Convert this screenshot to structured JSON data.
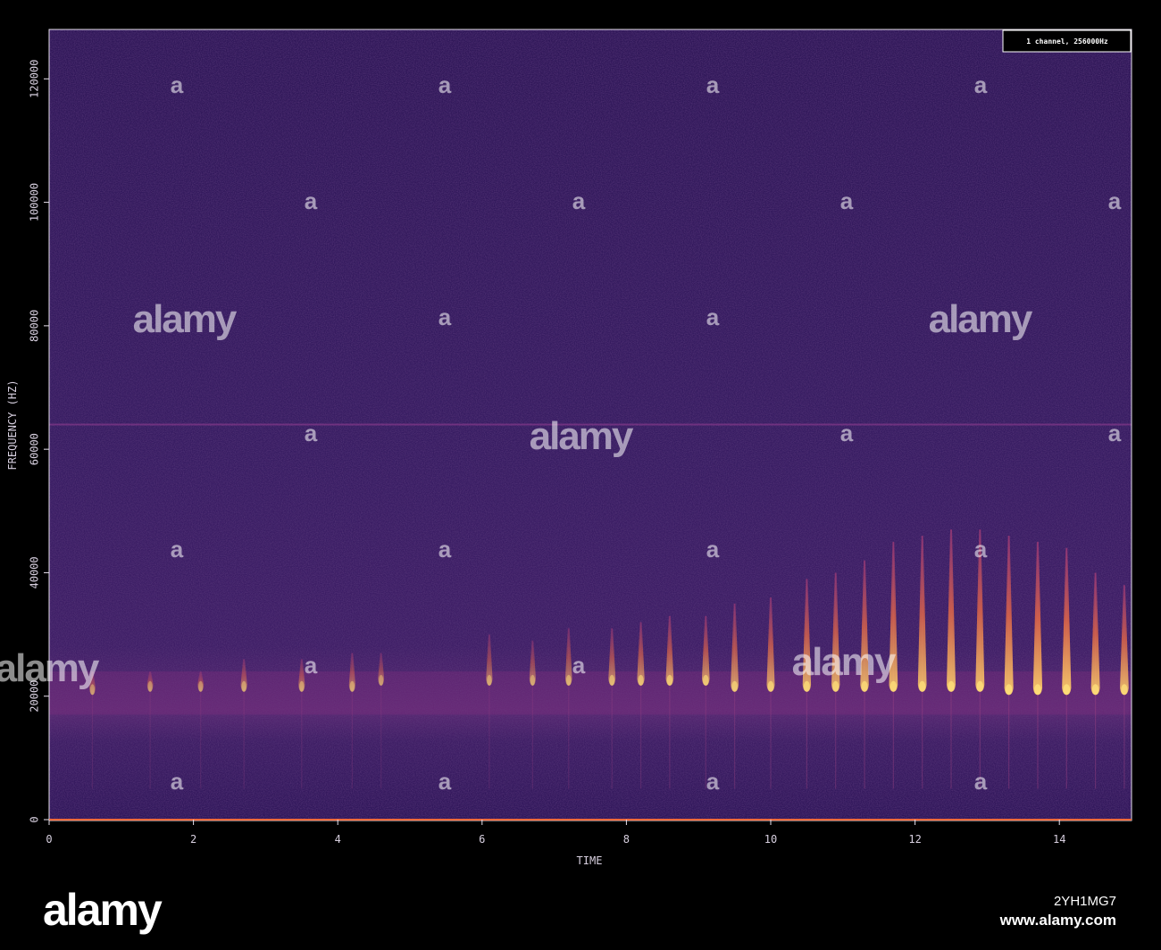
{
  "chart_data": {
    "type": "heatmap",
    "xlabel": "TIME",
    "ylabel": "FREQUENCY (HZ)",
    "xlim": [
      0,
      15
    ],
    "ylim": [
      0,
      128000
    ],
    "xticks": [
      0,
      2,
      4,
      6,
      8,
      10,
      12,
      14
    ],
    "yticks": [
      0,
      20000,
      40000,
      60000,
      80000,
      100000,
      120000
    ],
    "legend": "1 channel, 256000Hz",
    "legend_position": "top-right",
    "colormap": [
      "#000000",
      "#2a0f4a",
      "#3d1a6b",
      "#7a2d86",
      "#c0406a",
      "#f08a3a",
      "#ffe07a"
    ],
    "background_level": 0.22,
    "tonal_line": {
      "frequency": 64000,
      "intensity": 0.35
    },
    "base_band": {
      "frequency_range": [
        17000,
        24000
      ],
      "intensity": 0.4
    },
    "calls": [
      {
        "time": 0.6,
        "f_high": 24000,
        "f_low": 20500,
        "intensity": 0.45
      },
      {
        "time": 1.4,
        "f_high": 24000,
        "f_low": 21000,
        "intensity": 0.45
      },
      {
        "time": 2.1,
        "f_high": 24000,
        "f_low": 21000,
        "intensity": 0.45
      },
      {
        "time": 2.7,
        "f_high": 26000,
        "f_low": 21000,
        "intensity": 0.5
      },
      {
        "time": 3.5,
        "f_high": 26000,
        "f_low": 21000,
        "intensity": 0.5
      },
      {
        "time": 4.2,
        "f_high": 27000,
        "f_low": 21000,
        "intensity": 0.5
      },
      {
        "time": 4.6,
        "f_high": 27000,
        "f_low": 22000,
        "intensity": 0.45
      },
      {
        "time": 6.1,
        "f_high": 30000,
        "f_low": 22000,
        "intensity": 0.5
      },
      {
        "time": 6.7,
        "f_high": 29000,
        "f_low": 22000,
        "intensity": 0.5
      },
      {
        "time": 7.2,
        "f_high": 31000,
        "f_low": 22000,
        "intensity": 0.55
      },
      {
        "time": 7.8,
        "f_high": 31000,
        "f_low": 22000,
        "intensity": 0.6
      },
      {
        "time": 8.2,
        "f_high": 32000,
        "f_low": 22000,
        "intensity": 0.65
      },
      {
        "time": 8.6,
        "f_high": 33000,
        "f_low": 22000,
        "intensity": 0.7
      },
      {
        "time": 9.1,
        "f_high": 33000,
        "f_low": 22000,
        "intensity": 0.7
      },
      {
        "time": 9.5,
        "f_high": 35000,
        "f_low": 21000,
        "intensity": 0.72
      },
      {
        "time": 10.0,
        "f_high": 36000,
        "f_low": 21000,
        "intensity": 0.75
      },
      {
        "time": 10.5,
        "f_high": 39000,
        "f_low": 21000,
        "intensity": 0.8
      },
      {
        "time": 10.9,
        "f_high": 40000,
        "f_low": 21000,
        "intensity": 0.8
      },
      {
        "time": 11.3,
        "f_high": 42000,
        "f_low": 21000,
        "intensity": 0.82
      },
      {
        "time": 11.7,
        "f_high": 45000,
        "f_low": 21000,
        "intensity": 0.85
      },
      {
        "time": 12.1,
        "f_high": 46000,
        "f_low": 21000,
        "intensity": 0.85
      },
      {
        "time": 12.5,
        "f_high": 47000,
        "f_low": 21000,
        "intensity": 0.88
      },
      {
        "time": 12.9,
        "f_high": 47000,
        "f_low": 21000,
        "intensity": 0.88
      },
      {
        "time": 13.3,
        "f_high": 46000,
        "f_low": 20500,
        "intensity": 0.9
      },
      {
        "time": 13.7,
        "f_high": 45000,
        "f_low": 20500,
        "intensity": 0.92
      },
      {
        "time": 14.1,
        "f_high": 44000,
        "f_low": 20500,
        "intensity": 0.92
      },
      {
        "time": 14.5,
        "f_high": 40000,
        "f_low": 20500,
        "intensity": 0.88
      },
      {
        "time": 14.9,
        "f_high": 38000,
        "f_low": 20500,
        "intensity": 0.85
      }
    ]
  },
  "watermark": {
    "text": "alamy",
    "big_positions_label": "alamy"
  },
  "footer": {
    "logo": "alamy",
    "image_id": "2YH1MG7",
    "site": "www.alamy.com"
  }
}
